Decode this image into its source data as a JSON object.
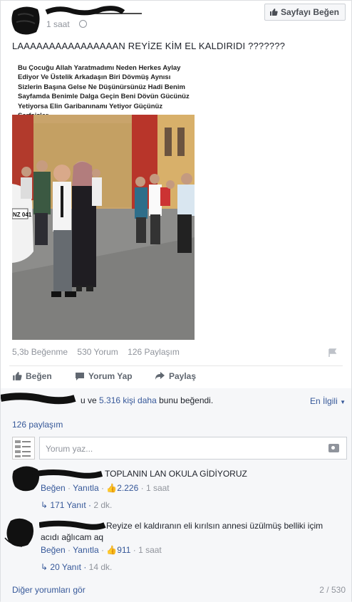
{
  "post": {
    "time": "1 saat",
    "like_page_label": "Sayfayı Beğen",
    "text": "LAAAAAAAAAAAAAAAAN REYİZE KİM EL KALDIRIDI ???????",
    "photo_caption": "Bu Çocuğu Allah Yaratmadımı Neden Herkes Aylay Ediyor Ve Üstelik Arkadaşın Biri Dövmüş Aynısı Sizlerin Başına Gelse Ne Düşünürsünüz Hadi Benim Sayfamda Benimle Dalga Geçin Beni Dövün Gücünüz Yetiyorsa Elin Garibanınamı Yetiyor Güçünüz Serfsizler",
    "plate_text": "NZ 041",
    "stats": {
      "likes": "5,3b Beğenme",
      "comments": "530 Yorum",
      "shares": "126 Paylaşım"
    },
    "actions": {
      "like": "Beğen",
      "comment": "Yorum Yap",
      "share": "Paylaş"
    }
  },
  "social": {
    "likes_prefix": "u ve",
    "likes_more": "5.316 kişi daha",
    "likes_suffix": "bunu beğendi.",
    "related": "En İlgili",
    "share_count": "126 paylaşım",
    "comment_placeholder": "Yorum yaz..."
  },
  "comments": [
    {
      "text": "TOPLANIN LAN OKULA GİDİYORUZ",
      "like": "Beğen",
      "reply": "Yanıtla",
      "like_count": "2.226",
      "time": "1 saat",
      "replies": "171 Yanıt",
      "replies_time": "2 dk."
    },
    {
      "text_line1": "Reyize el kaldıranın eli kırılsın annesi üzülmüş belliki içim",
      "text_line2": "acıdı ağlıcam aq",
      "like": "Beğen",
      "reply": "Yanıtla",
      "like_count": "911",
      "time": "1 saat",
      "replies": "20 Yanıt",
      "replies_time": "14 dk."
    }
  ],
  "footer": {
    "more_comments": "Diğer yorumları gör",
    "pager": "2 / 530"
  }
}
